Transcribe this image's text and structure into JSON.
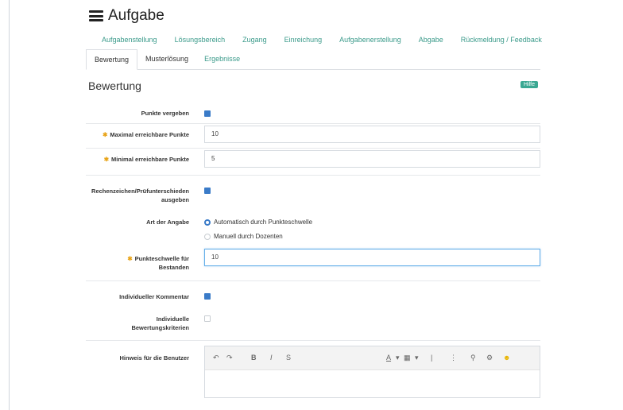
{
  "header": {
    "title": "Aufgabe"
  },
  "subtabs": [
    "Aufgabenstellung",
    "Lösungsbereich",
    "Zugang",
    "Einreichung",
    "Aufgabenerstellung",
    "Abgabe",
    "Rückmeldung / Feedback"
  ],
  "tabs": [
    {
      "label": "Bewertung",
      "active": true
    },
    {
      "label": "Musterlösung",
      "active": false
    },
    {
      "label": "Ergebnisse",
      "active": false,
      "link": true
    }
  ],
  "section": {
    "title": "Bewertung",
    "help_label": "Hilfe"
  },
  "fields": {
    "punkte_vergeben": {
      "label": "Punkte vergeben",
      "checked": true
    },
    "max_points": {
      "label": "Maximal erreichbare Punkte",
      "value": "10",
      "required": true
    },
    "min_points": {
      "label": "Minimal erreichbare Punkte",
      "value": "5",
      "required": true
    },
    "rounding": {
      "label_line1": "Rechenzeichen/Prüfunterschieden",
      "label_line2": "ausgeben",
      "checked": true
    },
    "grade_type": {
      "label": "Art der Angabe",
      "options": [
        {
          "label": "Automatisch durch Punkteschwelle",
          "selected": true
        },
        {
          "label": "Manuell durch Dozenten",
          "selected": false
        }
      ]
    },
    "threshold": {
      "label_line1": "Punkteschwelle für",
      "label_line2": "Bestanden",
      "value": "10",
      "required": true
    },
    "individual_comments": {
      "label": "Individueller Kommentar",
      "checked": true
    },
    "individual_rating": {
      "label_line1": "Individuelle",
      "label_line2": "Bewertungskriterien",
      "checked": false
    },
    "notes": {
      "label": "Hinweis für die Benutzer"
    }
  },
  "colors": {
    "accent": "#3a7bc8",
    "link": "#3a9a8a",
    "required_star": "#e8a317",
    "help_badge": "#3aa892"
  }
}
